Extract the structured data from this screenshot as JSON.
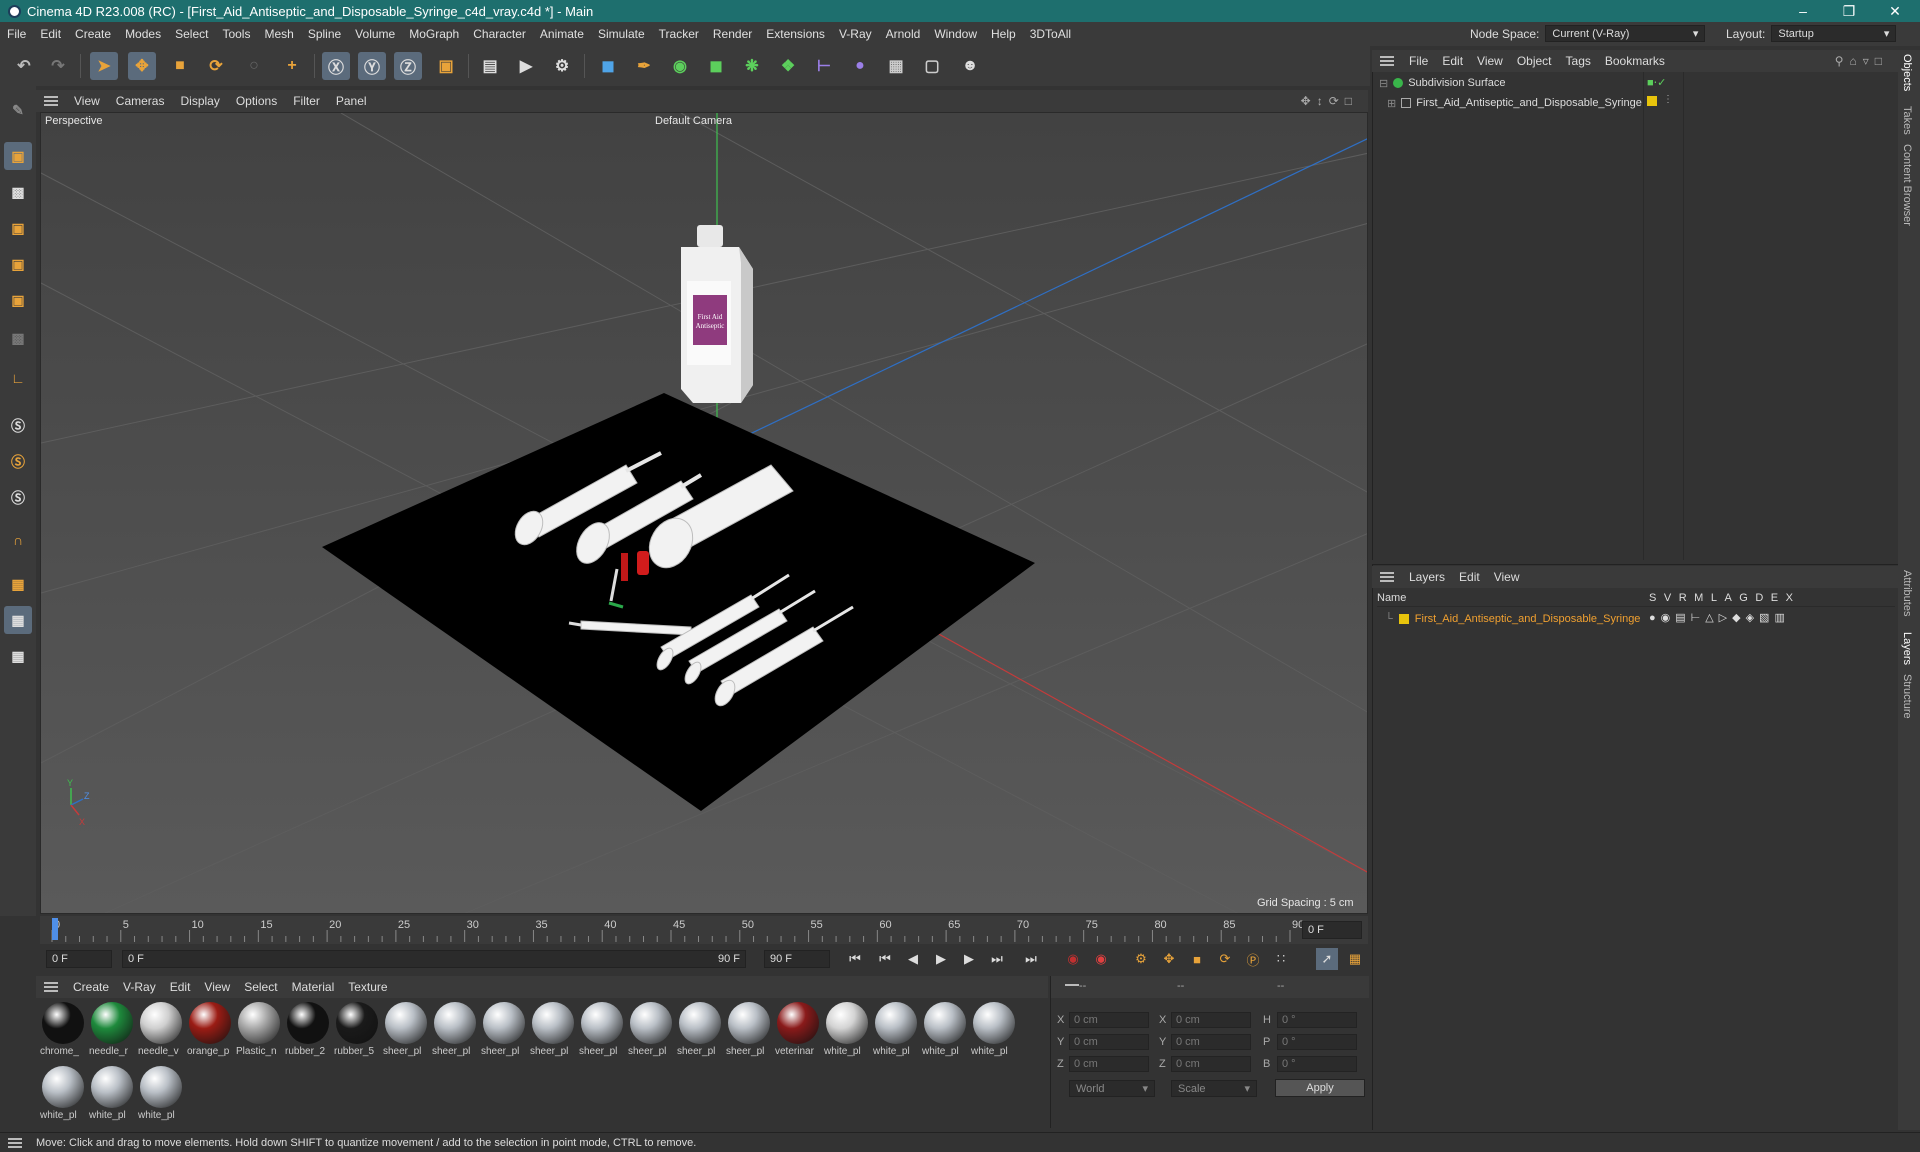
{
  "window": {
    "title": "Cinema 4D R23.008 (RC) - [First_Aid_Antiseptic_and_Disposable_Syringe_c4d_vray.c4d *] - Main"
  },
  "menu": [
    "File",
    "Edit",
    "Create",
    "Modes",
    "Select",
    "Tools",
    "Mesh",
    "Spline",
    "Volume",
    "MoGraph",
    "Character",
    "Animate",
    "Simulate",
    "Tracker",
    "Render",
    "Extensions",
    "V-Ray",
    "Arnold",
    "Window",
    "Help",
    "3DToAll"
  ],
  "nodespace": {
    "label": "Node Space:",
    "value": "Current (V-Ray)"
  },
  "layout": {
    "label": "Layout:",
    "value": "Startup"
  },
  "viewport": {
    "menu": [
      "View",
      "Cameras",
      "Display",
      "Options",
      "Filter",
      "Panel"
    ],
    "name": "Perspective",
    "camera": "Default Camera",
    "grid_spacing": "Grid Spacing : 5 cm",
    "axis": {
      "x": "X",
      "y": "Y",
      "z": "Z"
    }
  },
  "bottle_label": {
    "line1": "First Aid",
    "line2": "Antiseptic"
  },
  "timeline": {
    "ticks": [
      "0",
      "5",
      "10",
      "15",
      "20",
      "25",
      "30",
      "35",
      "40",
      "45",
      "50",
      "55",
      "60",
      "65",
      "70",
      "75",
      "80",
      "85",
      "90"
    ],
    "current_frame": "0 F"
  },
  "transport": {
    "start": "0 F",
    "range_start": "0 F",
    "range_end": "90 F",
    "end": "90 F"
  },
  "materials": {
    "menu": [
      "Create",
      "V-Ray",
      "Edit",
      "View",
      "Select",
      "Material",
      "Texture"
    ],
    "items": [
      {
        "name": "chrome_",
        "color": "#111111"
      },
      {
        "name": "needle_r",
        "color": "#1e8a3c"
      },
      {
        "name": "needle_v",
        "color": "#cfcfcf"
      },
      {
        "name": "orange_p",
        "color": "#9b1c14"
      },
      {
        "name": "Plastic_n",
        "color": "#a9a9a9"
      },
      {
        "name": "rubber_2",
        "color": "#111111"
      },
      {
        "name": "rubber_5",
        "color": "#1a1a1a"
      },
      {
        "name": "sheer_pl",
        "color": "#b9bfc6"
      },
      {
        "name": "sheer_pl",
        "color": "#b9bfc6"
      },
      {
        "name": "sheer_pl",
        "color": "#b9bfc6"
      },
      {
        "name": "sheer_pl",
        "color": "#b9bfc6"
      },
      {
        "name": "sheer_pl",
        "color": "#b9bfc6"
      },
      {
        "name": "sheer_pl",
        "color": "#b9bfc6"
      },
      {
        "name": "sheer_pl",
        "color": "#b9bfc6"
      },
      {
        "name": "sheer_pl",
        "color": "#b9bfc6"
      },
      {
        "name": "veterinar",
        "color": "#8a1a1a"
      },
      {
        "name": "white_pl",
        "color": "#d3d3d3"
      },
      {
        "name": "white_pl",
        "color": "#b9bfc6"
      },
      {
        "name": "white_pl",
        "color": "#b9bfc6"
      },
      {
        "name": "white_pl",
        "color": "#b9bfc6"
      },
      {
        "name": "white_pl",
        "color": "#b9bfc6"
      },
      {
        "name": "white_pl",
        "color": "#b9bfc6"
      },
      {
        "name": "white_pl",
        "color": "#b9bfc6"
      }
    ]
  },
  "coords": {
    "headers": [
      "--",
      "--",
      "--"
    ],
    "rows": [
      {
        "a": "X",
        "av": "0 cm",
        "b": "X",
        "bv": "0 cm",
        "c": "H",
        "cv": "0 °"
      },
      {
        "a": "Y",
        "av": "0 cm",
        "b": "Y",
        "bv": "0 cm",
        "c": "P",
        "cv": "0 °"
      },
      {
        "a": "Z",
        "av": "0 cm",
        "b": "Z",
        "bv": "0 cm",
        "c": "B",
        "cv": "0 °"
      }
    ],
    "space": "World",
    "mode": "Scale",
    "apply": "Apply"
  },
  "objects": {
    "menu": [
      "File",
      "Edit",
      "View",
      "Object",
      "Tags",
      "Bookmarks"
    ],
    "items": [
      {
        "name": "Subdivision Surface"
      },
      {
        "name": "First_Aid_Antiseptic_and_Disposable_Syringe"
      }
    ]
  },
  "layers": {
    "menu": [
      "Layers",
      "Edit",
      "View"
    ],
    "col_name": "Name",
    "cols": [
      "S",
      "V",
      "R",
      "M",
      "L",
      "A",
      "G",
      "D",
      "E",
      "X"
    ],
    "items": [
      {
        "name": "First_Aid_Antiseptic_and_Disposable_Syringe",
        "color": "#e8c40c"
      }
    ]
  },
  "right_tabs": [
    "Objects",
    "Takes",
    "Content Browser",
    "Attributes",
    "Layers",
    "Structure"
  ],
  "status": "Move: Click and drag to move elements. Hold down SHIFT to quantize movement / add to the selection in point mode, CTRL to remove."
}
